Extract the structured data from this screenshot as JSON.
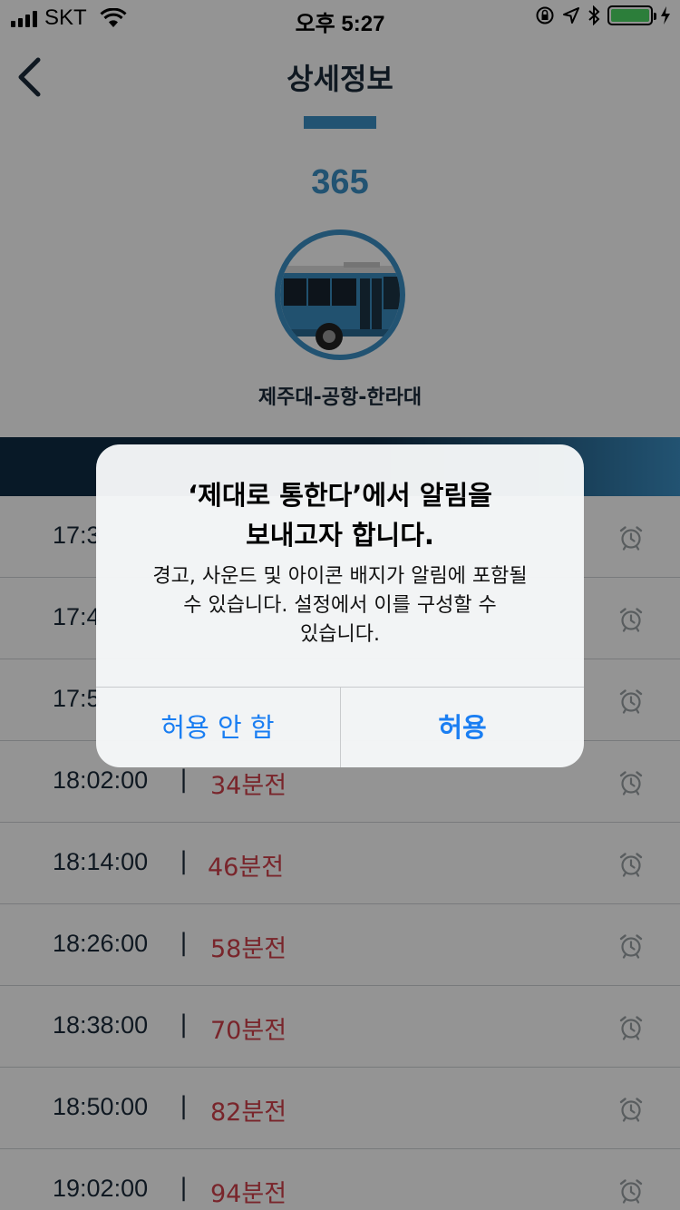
{
  "status_bar": {
    "carrier": "SKT",
    "time": "오후 5:27",
    "battery_level": 1.0
  },
  "header": {
    "title": "상세정보",
    "back_icon": "chevron-left-icon"
  },
  "route": {
    "number": "365",
    "name": "제주대-공항-한라대"
  },
  "arrivals": [
    {
      "time": "17:3",
      "separator": "|",
      "remaining": ""
    },
    {
      "time": "17:4",
      "separator": "|",
      "remaining": ""
    },
    {
      "time": "17:5",
      "separator": "|",
      "remaining": ""
    },
    {
      "time": "18:02:00",
      "separator": "|",
      "remaining": "34분전"
    },
    {
      "time": "18:14:00",
      "separator": "|",
      "remaining": "46분전"
    },
    {
      "time": "18:26:00",
      "separator": "|",
      "remaining": "58분전"
    },
    {
      "time": "18:38:00",
      "separator": "|",
      "remaining": "70분전"
    },
    {
      "time": "18:50:00",
      "separator": "|",
      "remaining": "82분전"
    },
    {
      "time": "19:02:00",
      "separator": "|",
      "remaining": "94분전"
    }
  ],
  "alert": {
    "title_line1": "‘제대로 통한다’에서 알림을",
    "title_line2": "보내고자 합니다.",
    "message_line1": "경고, 사운드 및 아이콘 배지가 알림에 포함될",
    "message_line2": "수 있습니다. 설정에서 이를 구성할 수",
    "message_line3": "있습니다.",
    "deny_label": "허용 안 함",
    "allow_label": "허용"
  },
  "colors": {
    "accent": "#3b8fc4",
    "navy": "#0f2c44",
    "remaining_text": "#d0414a",
    "alert_button": "#1a7ef2"
  }
}
